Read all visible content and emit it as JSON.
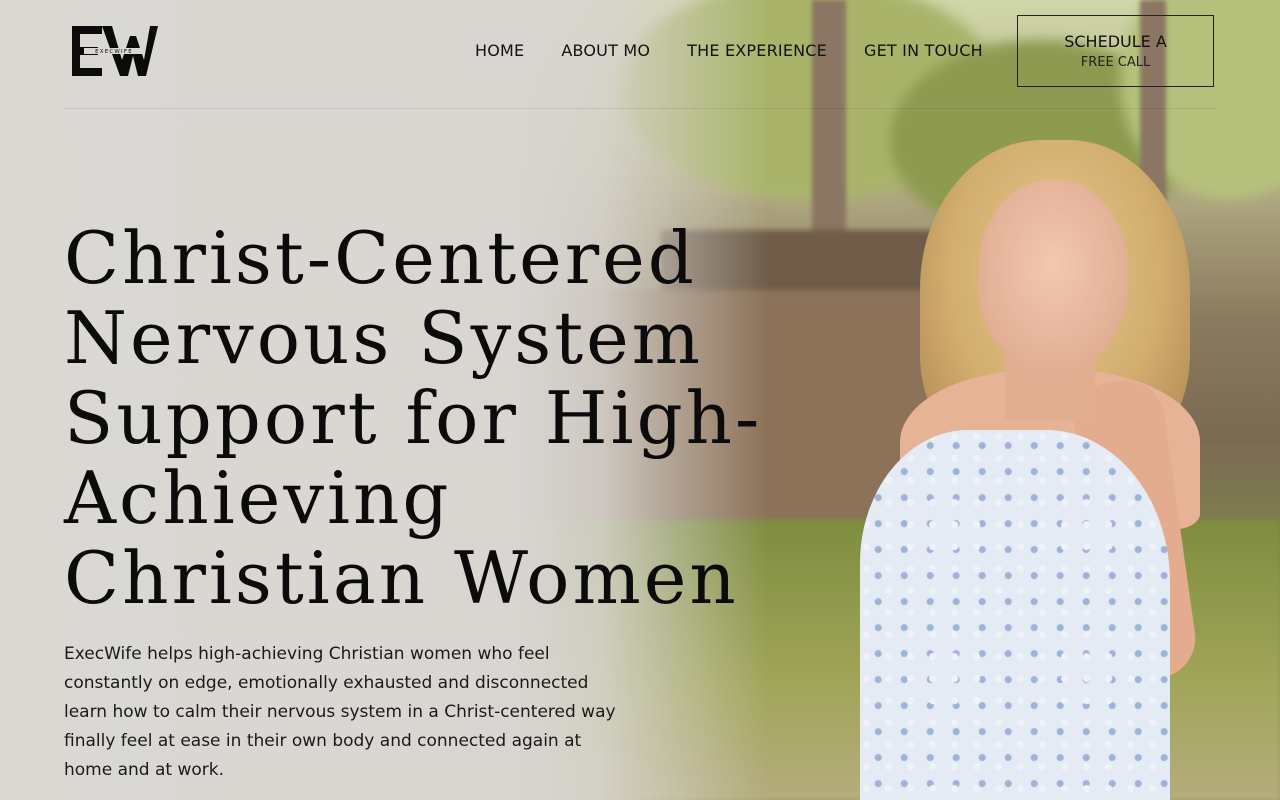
{
  "brand": {
    "logo_monogram": "EW",
    "logo_wordmark": "EXECWIFE"
  },
  "nav": {
    "items": [
      {
        "label": "HOME"
      },
      {
        "label": "ABOUT MO"
      },
      {
        "label": "THE EXPERIENCE"
      },
      {
        "label": "GET IN TOUCH"
      }
    ],
    "cta_line1": "SCHEDULE A",
    "cta_line2": "FREE CALL"
  },
  "hero": {
    "headline": "Christ-Centered Nervous System Support for High-Achieving Christian Women",
    "description": "ExecWife helps high-achieving Christian women who feel constantly on edge, emotionally exhausted and disconnected learn how to calm their nervous system in a Christ-centered way finally feel at ease in their own body and connected again at home and at work."
  },
  "colors": {
    "text": "#111111",
    "background": "#dcd9d5",
    "cta_border": "#222222"
  }
}
